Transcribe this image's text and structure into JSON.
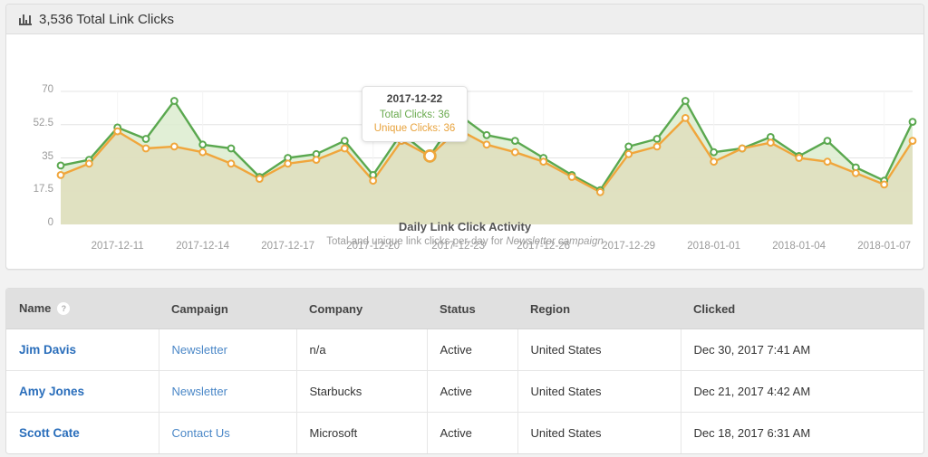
{
  "header": {
    "icon": "bar-chart-icon",
    "title": "3,536 Total Link Clicks"
  },
  "chart_caption": {
    "title": "Daily Link Click Activity",
    "subtitle_prefix": "Total and unique link clicks per-day for ",
    "subtitle_emphasis": "Newsletter campaign"
  },
  "tooltip": {
    "date": "2017-12-22",
    "total_label": "Total Clicks: 36",
    "unique_label": "Unique Clicks: 36"
  },
  "colors": {
    "total_clicks": "#5aa84f",
    "unique_clicks": "#f0a63c",
    "total_fill": "#dceccf",
    "unique_fill": "#dfdfc0",
    "link": "#2a6ebb",
    "grid": "#e4e4e4"
  },
  "chart_data": {
    "type": "area",
    "title": "Daily Link Click Activity",
    "subtitle": "Total and unique link clicks per-day for Newsletter campaign",
    "xlabel": "",
    "ylabel": "",
    "ylim": [
      0,
      70
    ],
    "yticks": [
      0,
      17.5,
      35,
      52.5,
      70
    ],
    "ytick_labels": [
      "0",
      "17.5",
      "35",
      "52.5",
      "70"
    ],
    "grid": true,
    "legend": "none",
    "highlight_index": 13,
    "x": [
      "2017-12-09",
      "2017-12-10",
      "2017-12-11",
      "2017-12-12",
      "2017-12-13",
      "2017-12-14",
      "2017-12-15",
      "2017-12-16",
      "2017-12-17",
      "2017-12-18",
      "2017-12-19",
      "2017-12-20",
      "2017-12-21",
      "2017-12-22",
      "2017-12-23",
      "2017-12-24",
      "2017-12-25",
      "2017-12-26",
      "2017-12-27",
      "2017-12-28",
      "2017-12-29",
      "2017-12-30",
      "2017-12-31",
      "2018-01-01",
      "2018-01-02",
      "2018-01-03",
      "2018-01-04",
      "2018-01-05",
      "2018-01-06",
      "2018-01-07",
      "2018-01-08"
    ],
    "xtick_labels": [
      "2017-12-11",
      "2017-12-14",
      "2017-12-17",
      "2017-12-20",
      "2017-12-23",
      "2017-12-26",
      "2017-12-29",
      "2018-01-01",
      "2018-01-04",
      "2018-01-07"
    ],
    "xtick_indices": [
      2,
      5,
      8,
      11,
      14,
      17,
      20,
      23,
      26,
      29
    ],
    "series": [
      {
        "name": "Total Clicks",
        "color": "#5aa84f",
        "values": [
          31,
          34,
          51,
          45,
          65,
          42,
          40,
          25,
          35,
          37,
          44,
          26,
          48,
          36,
          58,
          47,
          44,
          35,
          26,
          18,
          41,
          45,
          65,
          38,
          40,
          46,
          36,
          44,
          30,
          23,
          54
        ]
      },
      {
        "name": "Unique Clicks",
        "color": "#f0a63c",
        "values": [
          26,
          32,
          49,
          40,
          41,
          38,
          32,
          24,
          32,
          34,
          40,
          23,
          44,
          36,
          50,
          42,
          38,
          33,
          25,
          17,
          37,
          41,
          56,
          33,
          40,
          43,
          35,
          33,
          27,
          21,
          44
        ]
      }
    ]
  },
  "table": {
    "columns": [
      {
        "key": "name",
        "label": "Name",
        "help_icon": "?"
      },
      {
        "key": "campaign",
        "label": "Campaign"
      },
      {
        "key": "company",
        "label": "Company"
      },
      {
        "key": "status",
        "label": "Status"
      },
      {
        "key": "region",
        "label": "Region"
      },
      {
        "key": "clicked",
        "label": "Clicked"
      }
    ],
    "rows": [
      {
        "name": "Jim Davis",
        "campaign": "Newsletter",
        "company": "n/a",
        "status": "Active",
        "region": "United States",
        "clicked": "Dec 30, 2017 7:41 AM"
      },
      {
        "name": "Amy Jones",
        "campaign": "Newsletter",
        "company": "Starbucks",
        "status": "Active",
        "region": "United States",
        "clicked": "Dec 21, 2017 4:42 AM"
      },
      {
        "name": "Scott Cate",
        "campaign": "Contact Us",
        "company": "Microsoft",
        "status": "Active",
        "region": "United States",
        "clicked": "Dec 18, 2017 6:31 AM"
      }
    ]
  }
}
